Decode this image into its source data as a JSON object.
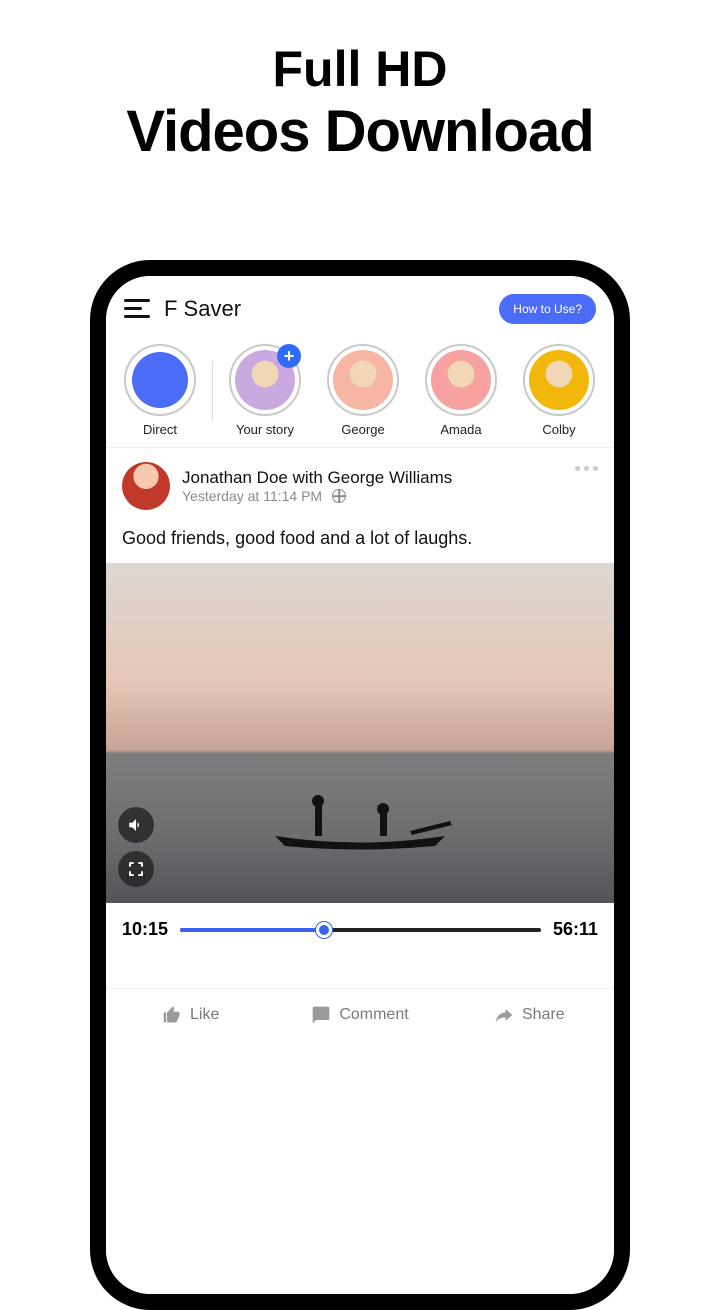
{
  "promo": {
    "line1": "Full HD",
    "line2": "Videos Download"
  },
  "header": {
    "title": "F Saver",
    "howto": "How to Use?"
  },
  "stories": [
    {
      "label": "Direct",
      "kind": "direct"
    },
    {
      "label": "Your story",
      "kind": "your"
    },
    {
      "label": "George",
      "kind": "user1"
    },
    {
      "label": "Amada",
      "kind": "user2"
    },
    {
      "label": "Colby",
      "kind": "user3"
    }
  ],
  "post": {
    "author": "Jonathan Doe with George Williams",
    "time": "Yesterday at 11:14 PM",
    "caption": "Good friends, good food and a lot of laughs."
  },
  "progress": {
    "current": "10:15",
    "total": "56:11"
  },
  "actions": {
    "like": "Like",
    "comment": "Comment",
    "share": "Share"
  }
}
